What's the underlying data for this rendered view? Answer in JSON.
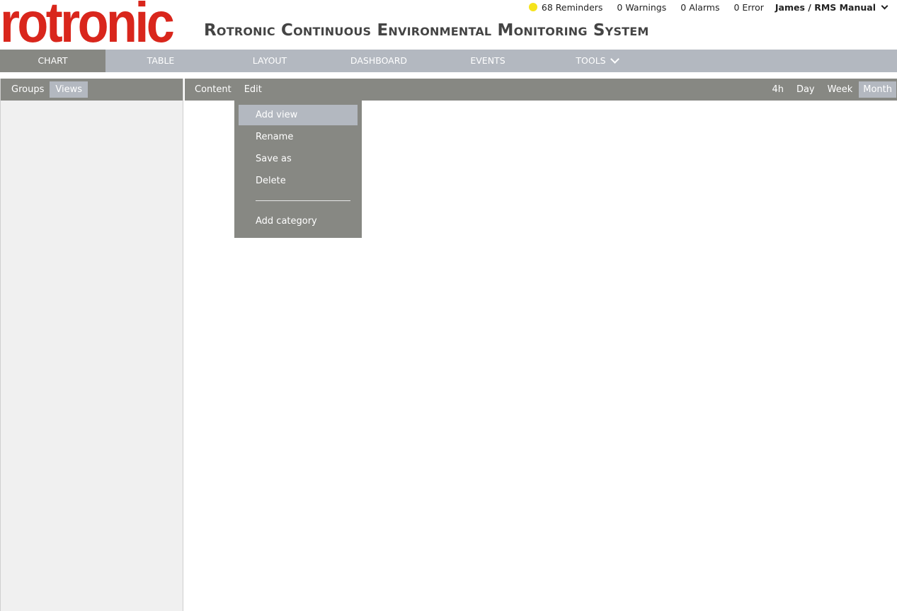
{
  "brand": {
    "logo_text": "rotronic",
    "logo_color": "#d9261c",
    "app_title": "Rotronic Continuous Environmental Monitoring System"
  },
  "status": {
    "reminders": "68 Reminders",
    "reminders_dot_color": "#f5e31c",
    "warnings": "0 Warnings",
    "alarms": "0 Alarms",
    "errors": "0 Error",
    "user": "James / RMS Manual"
  },
  "nav": {
    "items": [
      {
        "label": "CHART"
      },
      {
        "label": "TABLE"
      },
      {
        "label": "LAYOUT"
      },
      {
        "label": "DASHBOARD"
      },
      {
        "label": "EVENTS"
      },
      {
        "label": "TOOLS"
      }
    ],
    "active": "CHART"
  },
  "left_pane": {
    "tabs": [
      {
        "label": "Groups"
      },
      {
        "label": "Views"
      }
    ],
    "active": "Views"
  },
  "toolbar": {
    "content_label": "Content",
    "edit_label": "Edit",
    "ranges": [
      {
        "label": "4h"
      },
      {
        "label": "Day"
      },
      {
        "label": "Week"
      },
      {
        "label": "Month"
      }
    ],
    "active_range": "Month"
  },
  "edit_menu": {
    "items": [
      {
        "label": "Add view"
      },
      {
        "label": "Rename"
      },
      {
        "label": "Save as"
      },
      {
        "label": "Delete"
      }
    ],
    "extra": {
      "label": "Add category"
    },
    "highlighted": "Add view"
  },
  "colors": {
    "bar_gray": "#878883",
    "nav_blue_gray": "#b3b8c0",
    "pane_bg": "#f0f0f0"
  }
}
